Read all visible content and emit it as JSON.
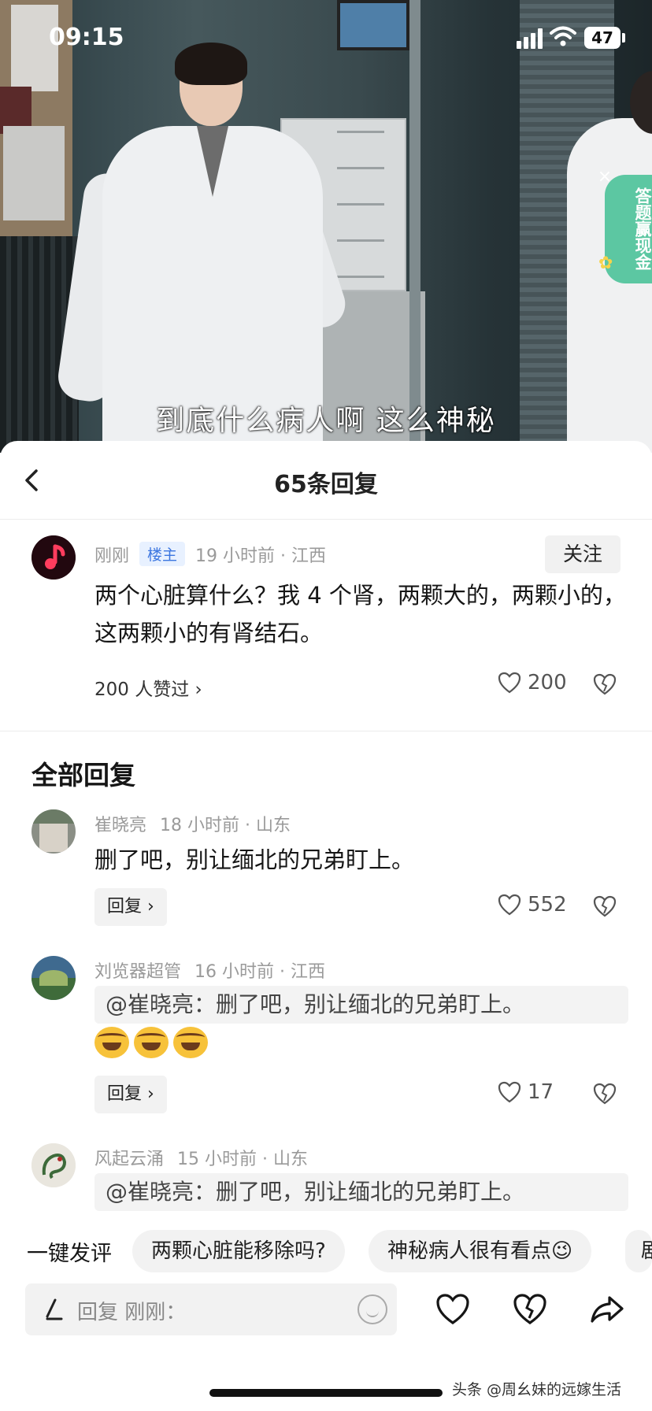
{
  "status_bar": {
    "time": "09:15",
    "battery": "47"
  },
  "video": {
    "subtitle": "到底什么病人啊 这么神秘",
    "quiz_badge": "答题赢现金"
  },
  "sheet": {
    "title": "65条回复",
    "main_comment": {
      "author": "刚刚",
      "tag": "楼主",
      "time_location": "19 小时前 · 江西",
      "follow_label": "关注",
      "text": "两个心脏算什么？我 4 个肾，两颗大的，两颗小的，这两颗小的有肾结石。",
      "likers": "200 人赞过",
      "like_count": "200"
    },
    "section_title": "全部回复",
    "replies": [
      {
        "author": "崔晓亮",
        "time_location": "18 小时前 · 山东",
        "text": "删了吧，别让缅北的兄弟盯上。",
        "reply_label": "回复",
        "like_count": "552"
      },
      {
        "author": "刘览器超管",
        "time_location": "16 小时前 · 江西",
        "quote": "@崔晓亮：删了吧，别让缅北的兄弟盯上。",
        "emoji_count": 3,
        "reply_label": "回复",
        "like_count": "17"
      },
      {
        "author": "风起云涌",
        "time_location": "15 小时前 · 山东",
        "quote": "@崔晓亮：删了吧，别让缅北的兄弟盯上。"
      }
    ],
    "quick_comments": {
      "label": "一键发评",
      "chips": [
        "两颗心脏能移除吗?",
        "神秘病人很有看点😉",
        "剧"
      ]
    },
    "input": {
      "placeholder": "回复 刚刚："
    }
  },
  "watermark": "头条 @周幺妹的远嫁生活",
  "colors": {
    "accent_tag": "#3c76e0",
    "quiz_badge": "#5cc7a2"
  }
}
